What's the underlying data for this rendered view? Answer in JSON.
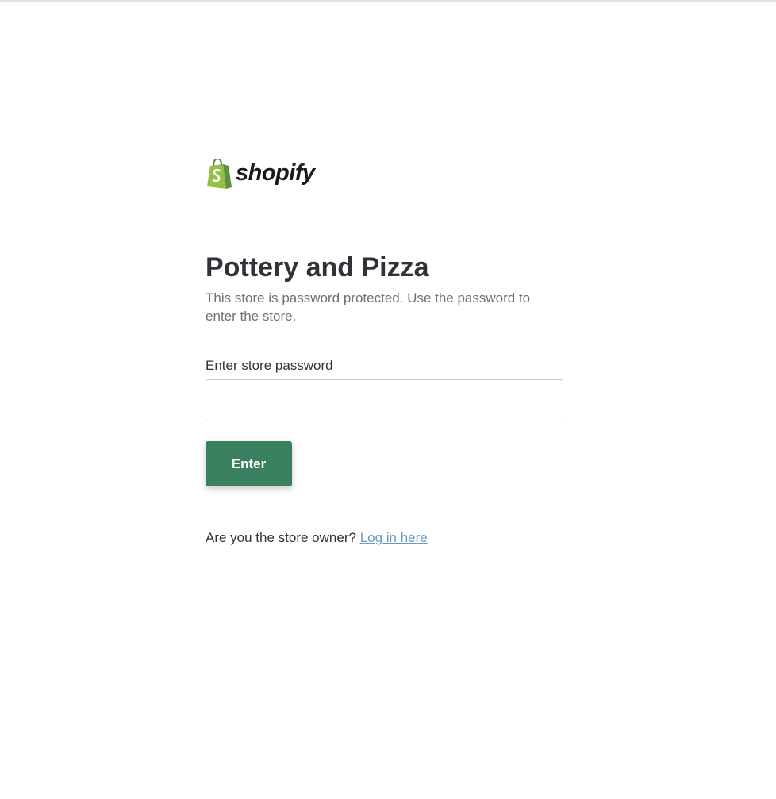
{
  "brand": {
    "name": "shopify",
    "logo_icon": "shopping-bag-icon",
    "colors": {
      "bag_light": "#95bf47",
      "bag_dark": "#5e8e3e",
      "text": "#1a1a1a"
    }
  },
  "store": {
    "title": "Pottery and Pizza",
    "description": "This store is password protected. Use the password to enter the store."
  },
  "form": {
    "password_label": "Enter store password",
    "password_value": "",
    "password_placeholder": "",
    "submit_label": "Enter"
  },
  "owner": {
    "prompt": "Are you the store owner?",
    "login_link": "Log in here"
  },
  "colors": {
    "button": "#3a7f5f",
    "link": "#6b9bbf",
    "heading": "#2f3338",
    "muted": "#6d7175"
  }
}
